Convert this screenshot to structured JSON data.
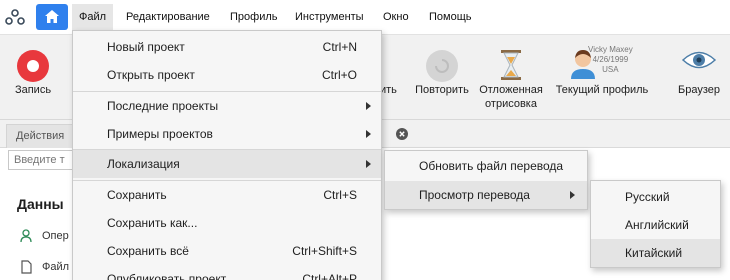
{
  "menubar": {
    "items": [
      "Файл",
      "Редактирование",
      "Профиль",
      "Инструменты",
      "Окно",
      "Помощь"
    ],
    "active_index": 0,
    "colors": {
      "home": "#2f80ed"
    }
  },
  "toolbar": {
    "record": "Запись",
    "repeat": "Повторить",
    "delayed_render": "Отложенная\nотрисовка",
    "current_profile": "Текущий профиль",
    "browser": "Браузер",
    "partial_repeat": "ить",
    "profile_caption": {
      "name": "Vicky Maxey",
      "date": "4/26/1999",
      "country": "USA"
    }
  },
  "tabs": {
    "actions": "Действия"
  },
  "search": {
    "placeholder": "Введите т"
  },
  "left_panel": {
    "title": "Данны",
    "rows": [
      "Опер",
      "Файл"
    ]
  },
  "file_menu": {
    "items": [
      {
        "label": "Новый проект",
        "shortcut": "Ctrl+N"
      },
      {
        "label": "Открыть проект",
        "shortcut": "Ctrl+O"
      },
      {
        "label": "Последние проекты",
        "submenu": true
      },
      {
        "label": "Примеры проектов",
        "submenu": true
      },
      {
        "label": "Локализация",
        "submenu": true,
        "highlighted": true
      },
      {
        "label": "Сохранить",
        "shortcut": "Ctrl+S"
      },
      {
        "label": "Сохранить как..."
      },
      {
        "label": "Сохранить всё",
        "shortcut": "Ctrl+Shift+S"
      },
      {
        "label": "Опубликовать проект",
        "shortcut": "Ctrl+Alt+P"
      }
    ]
  },
  "localization_menu": {
    "items": [
      {
        "label": "Обновить файл перевода"
      },
      {
        "label": "Просмотр перевода",
        "submenu": true,
        "highlighted": true
      }
    ]
  },
  "language_menu": {
    "items": [
      {
        "label": "Русский"
      },
      {
        "label": "Английский"
      },
      {
        "label": "Китайский",
        "highlighted": true
      }
    ]
  },
  "colors": {
    "accent": "#2f80ed",
    "record": "#e8383d",
    "highlight": "#e4e4e4"
  }
}
